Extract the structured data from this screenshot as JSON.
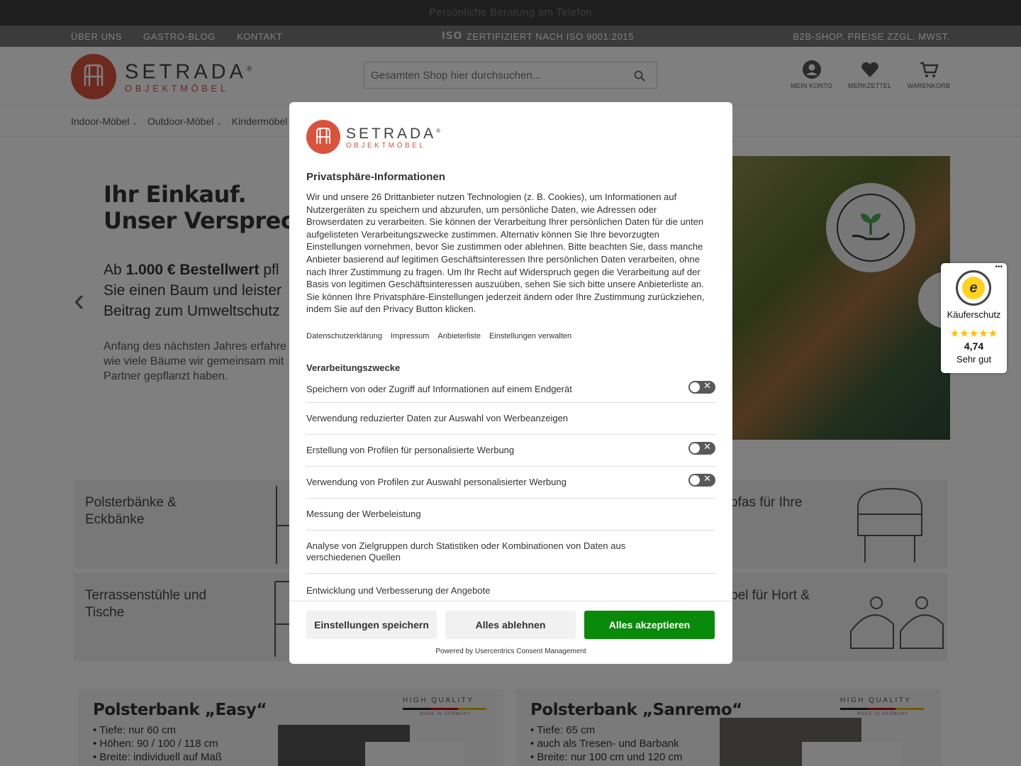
{
  "promo": {
    "text": "Persönliche Beratung am Telefon"
  },
  "topbar": {
    "links": [
      "ÜBER UNS",
      "GASTRO-BLOG",
      "KONTAKT"
    ],
    "iso_mark": "ISO",
    "certification": "ZERTIFIZIERT NACH ISO 9001:2015",
    "b2b": "B2B-SHOP. PREISE ZZGL. MWST."
  },
  "logo": {
    "word1": "SETRADA",
    "word2": "OBJEKTMÖBEL",
    "reg": "®"
  },
  "search": {
    "placeholder": "Gesamten Shop hier durchsuchen..."
  },
  "account": {
    "konto": "MEIN KONTO",
    "merkzettel": "MERKZETTEL",
    "warenkorb": "WARENKORB"
  },
  "nav": {
    "items": [
      "Indoor-Möbel",
      "Outdoor-Möbel",
      "Kindermöbel"
    ]
  },
  "hero": {
    "title_line1": "Ihr Einkauf.",
    "title_line2": "Unser Verspreche",
    "sub_prefix": "Ab ",
    "sub_bold": "1.000 € Bestellwert",
    "sub_rest1": " pfl",
    "sub_line2": "Sie einen Baum und leister",
    "sub_line3": "Beitrag zum Umweltschutz",
    "note_line1": "Anfang des nächsten Jahres erfahre",
    "note_line2": "wie viele Bäume wir gemeinsam mit",
    "note_line3": "Partner gepflanzt haben."
  },
  "tiles": {
    "t1": "Polsterbänke & Eckbänke",
    "t2": "ofas für Ihre",
    "t3": "Terrassenstühle und Tische",
    "t4": "bel für Hort &"
  },
  "products": [
    {
      "title": "Polsterbank „Easy“",
      "bullets": [
        "Tiefe: nur 60 cm",
        "Höhen: 90 / 100 / 118 cm",
        "Breite: individuell auf Maß"
      ],
      "hq": "HIGH QUALITY",
      "made": "MADE IN GERMANY"
    },
    {
      "title": "Polsterbank „Sanremo“",
      "bullets": [
        "Tiefe: 65 cm",
        "auch als Tresen- und Barbank",
        "Breite: nur 100 cm und 120 cm"
      ],
      "hq": "HIGH QUALITY",
      "made": "MADE IN GERMANY"
    }
  ],
  "consent": {
    "brand1": "SETRADA",
    "brand2": "OBJEKTMÖBEL",
    "title": "Privatsphäre-Informationen",
    "description": "Wir und unsere 26 Drittanbieter nutzen Technologien (z. B. Cookies), um Informationen auf Nutzergeräten zu speichern und abzurufen, um persönliche Daten, wie Adressen oder Browserdaten zu verarbeiten. Sie können der Verarbeitung Ihrer persönlichen Daten für die unten aufgelisteten Verarbeitungszwecke zustimmen. Alternativ können Sie Ihre bevorzugten Einstellungen vornehmen, bevor Sie zustimmen oder ablehnen. Bitte beachten Sie, dass manche Anbieter basierend auf legitimen Geschäftsinteressen Ihre persönlichen Daten verarbeiten, ohne nach Ihrer Zustimmung zu fragen. Um Ihr Recht auf Widerspruch gegen die Verarbeitung auf der Basis von legitimen Geschäftsinteressen auszuüben, sehen Sie sich bitte unsere Anbieterliste an. Sie können Ihre Privatsphäre-Einstellungen jederzeit ändern oder Ihre Zustimmung zurückziehen, indem Sie auf den Privacy Button klicken.",
    "links": [
      "Datenschutzerklärung",
      "Impressum",
      "Anbieterliste",
      "Einstellungen verwalten"
    ],
    "section_title": "Verarbeitungszwecke",
    "purposes": [
      {
        "label": "Speichern von oder Zugriff auf Informationen auf einem Endgerät",
        "toggle": true
      },
      {
        "label": "Verwendung reduzierter Daten zur Auswahl von Werbeanzeigen",
        "toggle": false
      },
      {
        "label": "Erstellung von Profilen für personalisierte Werbung",
        "toggle": true
      },
      {
        "label": "Verwendung von Profilen zur Auswahl personalisierter Werbung",
        "toggle": true
      },
      {
        "label": "Messung der Werbeleistung",
        "toggle": false
      },
      {
        "label": "Analyse von Zielgruppen durch Statistiken oder Kombinationen von Daten aus verschiedenen Quellen",
        "toggle": false
      },
      {
        "label": "Entwicklung und Verbesserung der Angebote",
        "toggle": false
      }
    ],
    "toggle_off_symbol": "✕",
    "buttons": {
      "save": "Einstellungen speichern",
      "reject": "Alles ablehnen",
      "accept": "Alles akzeptieren"
    },
    "powered": "Powered by Usercentrics Consent Management"
  },
  "trusted_shops": {
    "menu": "•••",
    "label": "Käuferschutz",
    "stars": "★★★★★",
    "score": "4,74",
    "grade": "Sehr gut",
    "seal_letter": "e"
  },
  "colors": {
    "brand": "#d9533c",
    "accept": "#0a8a0a",
    "topbar": "#767676",
    "promo": "#3d3d3d"
  }
}
